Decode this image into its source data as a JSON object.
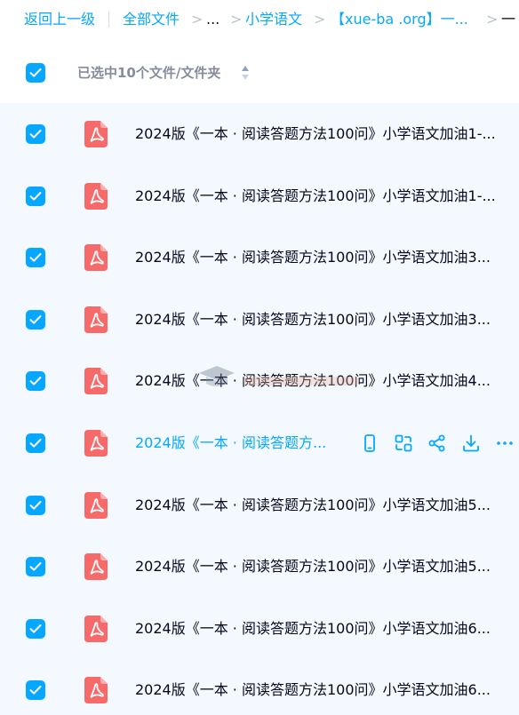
{
  "breadcrumb": {
    "back": "返回上一级",
    "all_files": "全部文件",
    "ellipsis": "...",
    "folder_1": "小学语文",
    "folder_2": "【xue-ba .org】一...",
    "folder_3": "一"
  },
  "header": {
    "selected_label": "已选中10个文件/文件夹"
  },
  "files": [
    {
      "name": "2024版《一本 · 阅读答题方法100问》小学语文加油1-...",
      "checked": true
    },
    {
      "name": "2024版《一本 · 阅读答题方法100问》小学语文加油1-...",
      "checked": true
    },
    {
      "name": "2024版《一本 · 阅读答题方法100问》小学语文加油3...",
      "checked": true
    },
    {
      "name": "2024版《一本 · 阅读答题方法100问》小学语文加油3...",
      "checked": true
    },
    {
      "name": "2024版《一本 · 阅读答题方法100问》小学语文加油4...",
      "checked": true
    },
    {
      "name": "2024版《一本 · 阅读答题方...",
      "checked": true,
      "hover": true
    },
    {
      "name": "2024版《一本 · 阅读答题方法100问》小学语文加油5...",
      "checked": true
    },
    {
      "name": "2024版《一本 · 阅读答题方法100问》小学语文加油5...",
      "checked": true
    },
    {
      "name": "2024版《一本 · 阅读答题方法100问》小学语文加油6...",
      "checked": true
    },
    {
      "name": "2024版《一本 · 阅读答题方法100问》小学语文加油6...",
      "checked": true
    }
  ],
  "row_actions": [
    "phone-icon",
    "transfer-icon",
    "share-icon",
    "download-icon",
    "more-icon"
  ],
  "colors": {
    "accent": "#06a7ff",
    "pdf": "#f25d5d",
    "list_bg": "#f3f9fe",
    "text": "#03081a"
  }
}
